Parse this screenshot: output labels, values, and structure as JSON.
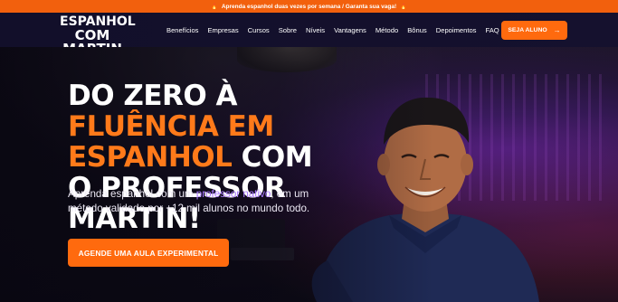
{
  "topbar": {
    "text_before": "Aprenda espanhol duas vezes por semana / ",
    "text_bold": "Garanta sua vaga!",
    "icon_left": "fire-icon",
    "icon_right": "fire-icon"
  },
  "logo": {
    "line1": "ESPANHOL",
    "line2": "COM MARTIN"
  },
  "nav": {
    "items": [
      "Benefícios",
      "Empresas",
      "Cursos",
      "Sobre",
      "Níveis",
      "Vantagens",
      "Método",
      "Bônus",
      "Depoimentos",
      "FAQ"
    ],
    "cta_label": "SEJA ALUNO",
    "cta_icon": "arrow-right-icon"
  },
  "hero": {
    "headline_part1": "DO ZERO À ",
    "headline_accent": "FLUÊNCIA EM ESPANHOL",
    "headline_part2": " COM O PROFESSOR MARTIN!",
    "sub_before": "Aprenda espanhol com um ",
    "sub_highlight": "professor nativo",
    "sub_after": ", em um método validado por +12 mil alunos no mundo todo.",
    "cta_label": "AGENDE UMA AULA EXPERIMENTAL"
  },
  "colors": {
    "accent": "#ff6a0e",
    "highlight": "#a878ff",
    "background": "#0d0b1e"
  }
}
